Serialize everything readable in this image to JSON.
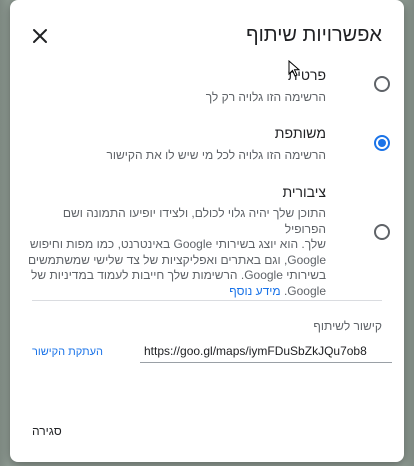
{
  "dialog": {
    "title": "אפשרויות שיתוף",
    "close_icon": "close-icon"
  },
  "options": [
    {
      "label": "פרטית",
      "description": "הרשימה הזו גלויה רק לך",
      "selected": false
    },
    {
      "label": "משותפת",
      "description": "הרשימה הזו גלויה לכל מי שיש לו את הקישור",
      "selected": true
    },
    {
      "label": "ציבורית",
      "description_lines": [
        "התוכן שלך יהיה גלוי לכולם, ולצידו יופיעו התמונה ושם הפרופיל",
        "שלך. הוא יוצג בשירותי Google באינטרנט, כמו מפות וחיפוש",
        "Google, וגם באתרים ואפליקציות של צד שלישי שמשתמשים",
        "בשירותי Google. הרשימות שלך חייבות לעמוד במדיניות של",
        "Google."
      ],
      "learn_more": "מידע נוסף",
      "selected": false
    }
  ],
  "share_link": {
    "label": "קישור לשיתוף",
    "url": "https://goo.gl/maps/iymFDuSbZkJQu7ob8",
    "copy_label": "העתקת הקישור"
  },
  "footer": {
    "close_label": "סגירה"
  },
  "colors": {
    "accent": "#1a73e8",
    "text": "#202124",
    "secondary_text": "#5f6368"
  }
}
